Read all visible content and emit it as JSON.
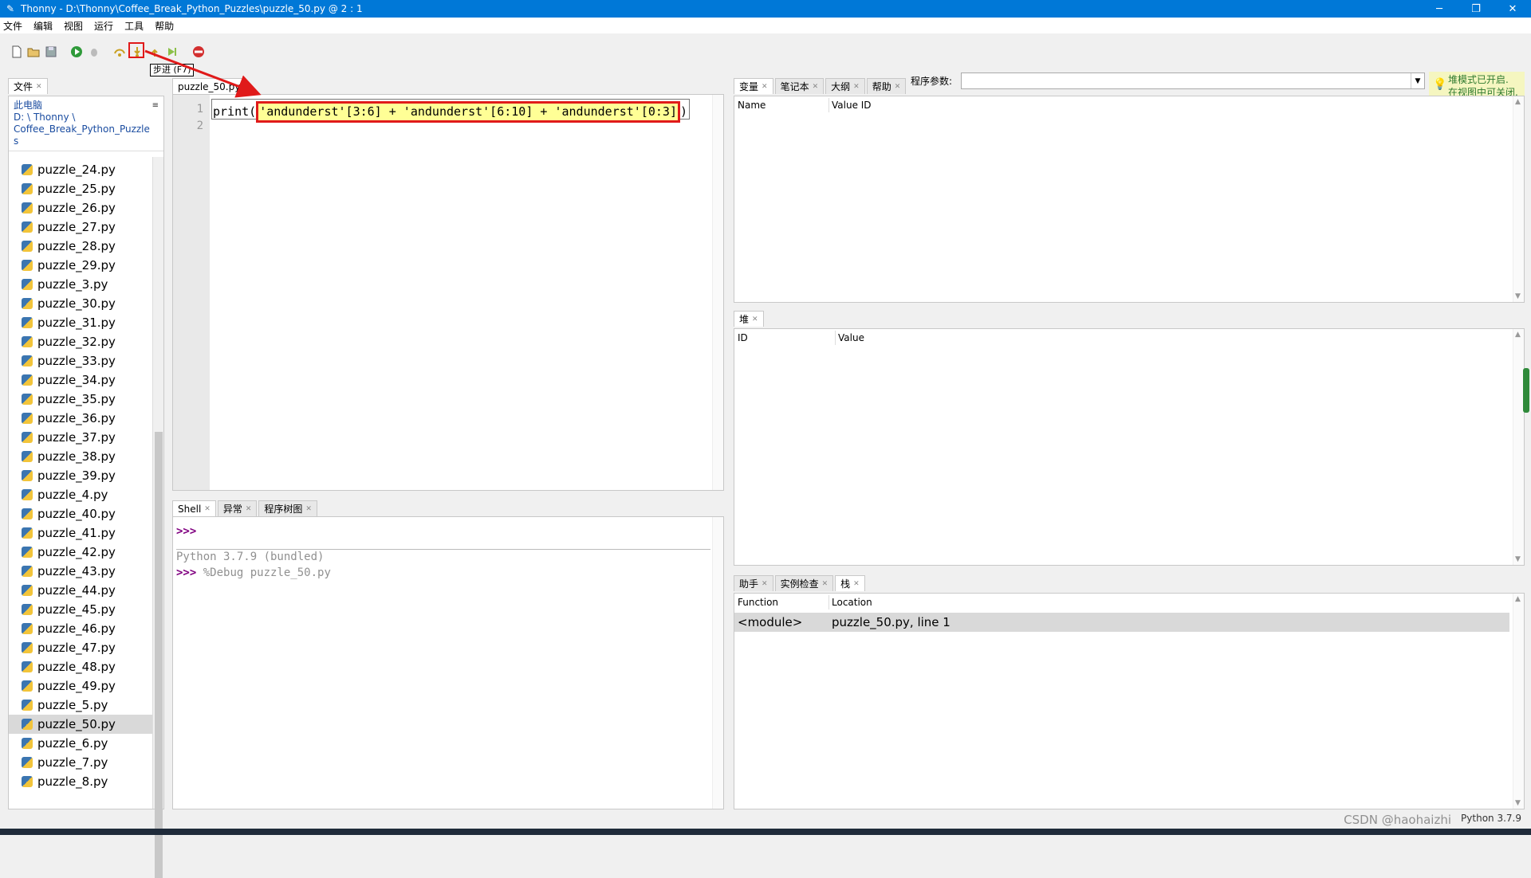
{
  "window": {
    "title": "Thonny  -  D:\\Thonny\\Coffee_Break_Python_Puzzles\\puzzle_50.py  @  2 : 1",
    "controls": [
      "─",
      "❐",
      "✕"
    ]
  },
  "menu": [
    "文件",
    "编辑",
    "视图",
    "运行",
    "工具",
    "帮助"
  ],
  "toolbar": {
    "tooltip": "步进 (F7)",
    "program_args_label": "程序参数:",
    "program_args_value": "",
    "hint_line1": "堆模式已开启.",
    "hint_line2": "在视图中可关闭."
  },
  "files": {
    "tab": "文件",
    "location_label": "此电脑",
    "path1": "D: \\ Thonny \\",
    "path2": "Coffee_Break_Python_Puzzle",
    "path3": "s",
    "items": [
      "puzzle_24.py",
      "puzzle_25.py",
      "puzzle_26.py",
      "puzzle_27.py",
      "puzzle_28.py",
      "puzzle_29.py",
      "puzzle_3.py",
      "puzzle_30.py",
      "puzzle_31.py",
      "puzzle_32.py",
      "puzzle_33.py",
      "puzzle_34.py",
      "puzzle_35.py",
      "puzzle_36.py",
      "puzzle_37.py",
      "puzzle_38.py",
      "puzzle_39.py",
      "puzzle_4.py",
      "puzzle_40.py",
      "puzzle_41.py",
      "puzzle_42.py",
      "puzzle_43.py",
      "puzzle_44.py",
      "puzzle_45.py",
      "puzzle_46.py",
      "puzzle_47.py",
      "puzzle_48.py",
      "puzzle_49.py",
      "puzzle_5.py",
      "puzzle_50.py",
      "puzzle_6.py",
      "puzzle_7.py",
      "puzzle_8.py"
    ],
    "selected": "puzzle_50.py"
  },
  "editor": {
    "tab": "puzzle_50.py",
    "line_numbers": [
      "1",
      "2"
    ],
    "code_prefix": "print(",
    "code_highlight": "'andunderst'[3:6] + 'andunderst'[6:10] + 'andunderst'[0:3]",
    "code_suffix": ")"
  },
  "shell": {
    "tabs": [
      "Shell",
      "异常",
      "程序树图"
    ],
    "prompt": ">>>",
    "version_line": "Python 3.7.9 (bundled)",
    "command": "%Debug puzzle_50.py"
  },
  "variables": {
    "tabs": [
      "变量",
      "笔记本",
      "大纲",
      "帮助"
    ],
    "col_name": "Name",
    "col_value": "Value ID"
  },
  "heap": {
    "tab": "堆",
    "col_id": "ID",
    "col_value": "Value"
  },
  "stack": {
    "tabs": [
      "助手",
      "实例检查",
      "栈"
    ],
    "col_function": "Function",
    "col_location": "Location",
    "row_function": "<module>",
    "row_location": "puzzle_50.py, line 1"
  },
  "status": {
    "python_version": "Python 3.7.9",
    "watermark": "CSDN @haohaizhi"
  },
  "colors": {
    "titlebar": "#0078d7",
    "highlight_bg": "#ffff96",
    "annotation_red": "#e01a1a",
    "prompt": "#800080"
  }
}
